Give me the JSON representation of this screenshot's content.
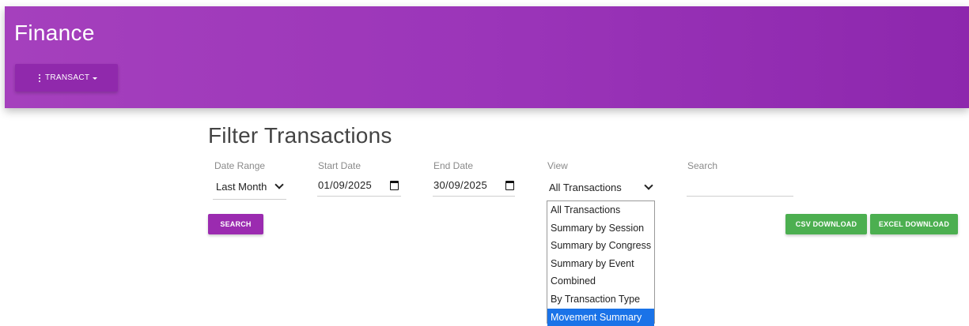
{
  "header": {
    "title": "Finance",
    "transact_label": "TRANSACT"
  },
  "filter": {
    "title": "Filter Transactions",
    "date_range": {
      "label": "Date Range",
      "value": "Last Month"
    },
    "start_date": {
      "label": "Start Date",
      "value": "01/09/2025"
    },
    "end_date": {
      "label": "End Date",
      "value": "30/09/2025"
    },
    "view": {
      "label": "View",
      "value": "All Transactions",
      "options": [
        "All Transactions",
        "Summary by Session",
        "Summary by Congress",
        "Summary by Event",
        "Combined",
        "By Transaction Type",
        "Movement Summary"
      ],
      "highlighted_option": "Movement Summary"
    },
    "search": {
      "label": "Search",
      "value": ""
    }
  },
  "actions": {
    "search_label": "SEARCH",
    "csv_label": "CSV DOWNLOAD",
    "excel_label": "EXCEL DOWNLOAD"
  },
  "colors": {
    "header_gradient_start": "#a540bd",
    "header_gradient_end": "#8d27ad",
    "primary_button": "#9b2bb0",
    "download_button": "#4caf50",
    "highlight": "#1a73e8"
  }
}
